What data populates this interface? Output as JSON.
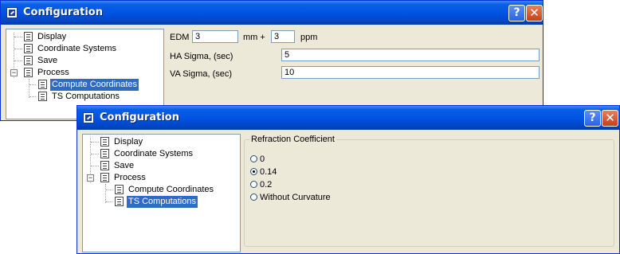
{
  "window_back": {
    "title": "Configuration",
    "tree": [
      "Display",
      "Coordinate Systems",
      "Save",
      "Process",
      "Compute Coordinates",
      "TS Computations"
    ],
    "selected": "Compute Coordinates",
    "form": {
      "edm_label": "EDM",
      "edm_mm_value": "3",
      "mm_plus_label": "mm +",
      "edm_ppm_value": "3",
      "ppm_label": "ppm",
      "ha_sigma_label": "HA Sigma, (sec)",
      "ha_sigma_value": "5",
      "va_sigma_label": "VA Sigma, (sec)",
      "va_sigma_value": "10"
    }
  },
  "window_front": {
    "title": "Configuration",
    "tree": [
      "Display",
      "Coordinate Systems",
      "Save",
      "Process",
      "Compute Coordinates",
      "TS Computations"
    ],
    "selected": "TS Computations",
    "refraction": {
      "group_label": "Refraction Coefficient",
      "options": [
        "0",
        "0.14",
        "0.2",
        "Without Curvature"
      ],
      "selected": "0.14"
    }
  },
  "buttons": {
    "help": "?",
    "close": "✕"
  },
  "icons": [
    "app-icon",
    "help-icon",
    "close-icon",
    "tree-node-icon"
  ]
}
